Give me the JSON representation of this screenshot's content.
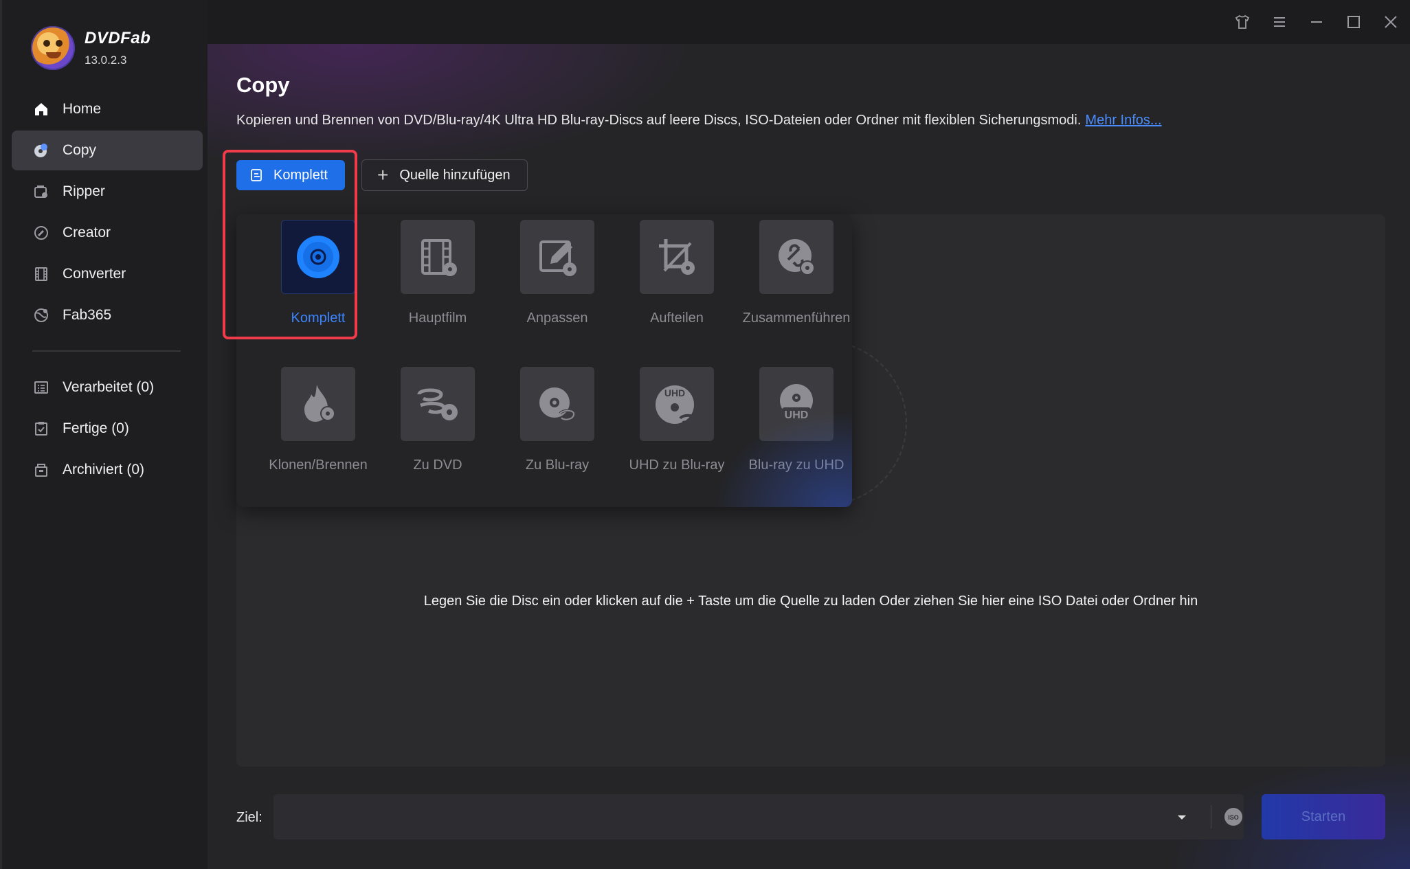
{
  "app": {
    "name": "DVDFab",
    "version": "13.0.2.3"
  },
  "sidebar": {
    "items": [
      {
        "label": "Home",
        "icon": "home-icon"
      },
      {
        "label": "Copy",
        "icon": "copy-disc-icon",
        "active": true
      },
      {
        "label": "Ripper",
        "icon": "ripper-icon"
      },
      {
        "label": "Creator",
        "icon": "creator-icon"
      },
      {
        "label": "Converter",
        "icon": "converter-icon"
      },
      {
        "label": "Fab365",
        "icon": "fab365-icon"
      }
    ],
    "task_items": [
      {
        "label": "Verarbeitet (0)",
        "icon": "processing-icon"
      },
      {
        "label": "Fertige (0)",
        "icon": "finished-icon"
      },
      {
        "label": "Archiviert (0)",
        "icon": "archive-icon"
      }
    ]
  },
  "page": {
    "title": "Copy",
    "description": "Kopieren und Brennen von DVD/Blu-ray/4K Ultra HD Blu-ray-Discs auf leere Discs, ISO-Dateien oder Ordner mit flexiblen Sicherungsmodi.",
    "more_link": "Mehr Infos..."
  },
  "toolbar": {
    "mode_button": "Komplett",
    "add_source": "Quelle hinzufügen"
  },
  "modes": [
    {
      "label": "Komplett",
      "icon": "disc-icon",
      "active": true
    },
    {
      "label": "Hauptfilm",
      "icon": "film-icon"
    },
    {
      "label": "Anpassen",
      "icon": "edit-icon"
    },
    {
      "label": "Aufteilen",
      "icon": "split-icon"
    },
    {
      "label": "Zusammenführen",
      "icon": "merge-icon"
    },
    {
      "label": "Klonen/Brennen",
      "icon": "burn-icon"
    },
    {
      "label": "Zu DVD",
      "icon": "to-dvd-icon"
    },
    {
      "label": "Zu Blu-ray",
      "icon": "to-bluray-icon"
    },
    {
      "label": "UHD zu Blu-ray",
      "icon": "uhd-to-bluray-icon"
    },
    {
      "label": "Blu-ray zu UHD",
      "icon": "bluray-to-uhd-icon"
    }
  ],
  "drop_hint": "Legen Sie die Disc ein oder klicken auf die + Taste um die Quelle zu laden Oder ziehen Sie hier eine ISO Datei oder Ordner hin",
  "output": {
    "label": "Ziel:",
    "value": "",
    "start_button": "Starten"
  },
  "colors": {
    "accent": "#1f6fe8",
    "highlight_border": "#ef3c4a",
    "active_label": "#3d84ff",
    "link": "#4a8cff"
  }
}
